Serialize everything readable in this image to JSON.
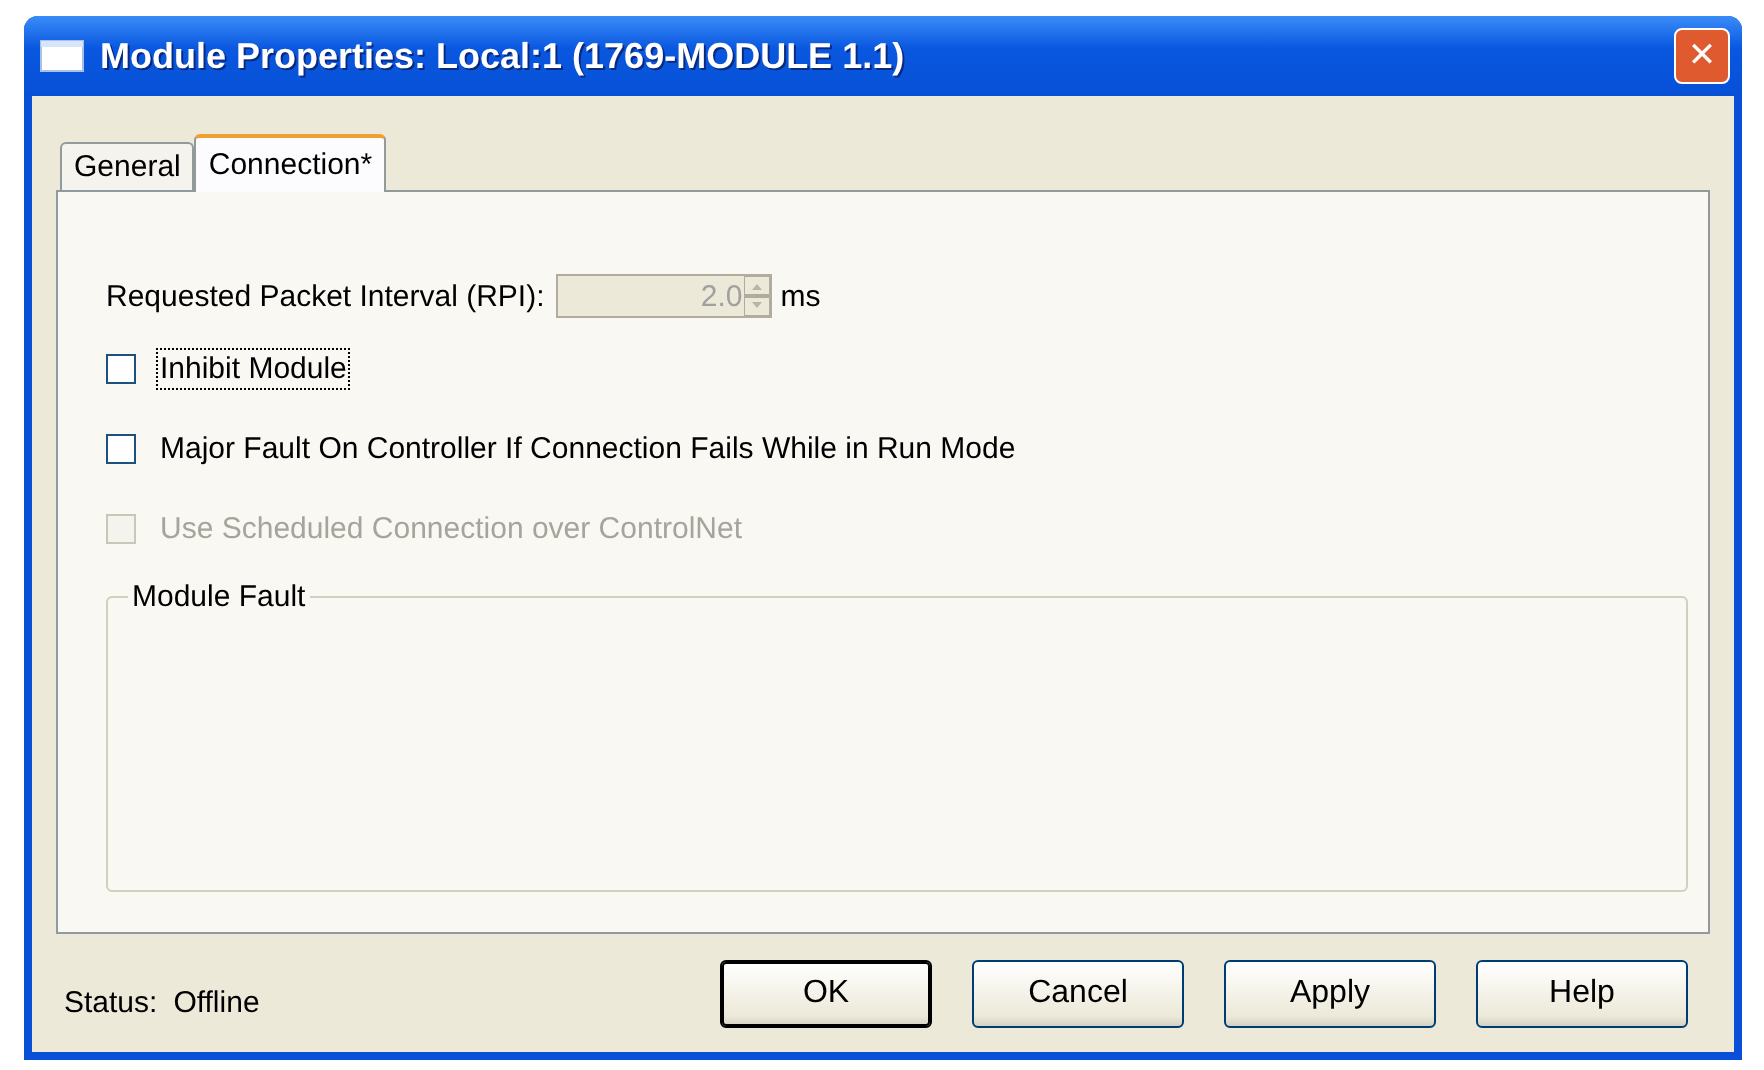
{
  "window": {
    "title": "Module Properties: Local:1 (1769-MODULE 1.1)",
    "close": "✕"
  },
  "tabs": [
    {
      "label": "General",
      "selected": false
    },
    {
      "label": "Connection*",
      "selected": true
    }
  ],
  "rpi": {
    "label": "Requested Packet Interval (RPI):",
    "value": "2.0",
    "unit": "ms",
    "disabled": true
  },
  "options": [
    {
      "label": "Inhibit Module",
      "checked": false,
      "disabled": false,
      "focused": true
    },
    {
      "label": "Major Fault On Controller If Connection Fails While in Run Mode",
      "checked": false,
      "disabled": false,
      "focused": false
    },
    {
      "label": "Use Scheduled Connection over ControlNet",
      "checked": false,
      "disabled": true,
      "focused": false
    }
  ],
  "module_fault": {
    "title": "Module Fault"
  },
  "status": {
    "label": "Status:",
    "value": "Offline"
  },
  "buttons": [
    {
      "label": "OK",
      "default": true
    },
    {
      "label": "Cancel",
      "default": false
    },
    {
      "label": "Apply",
      "default": false
    },
    {
      "label": "Help",
      "default": false
    }
  ]
}
